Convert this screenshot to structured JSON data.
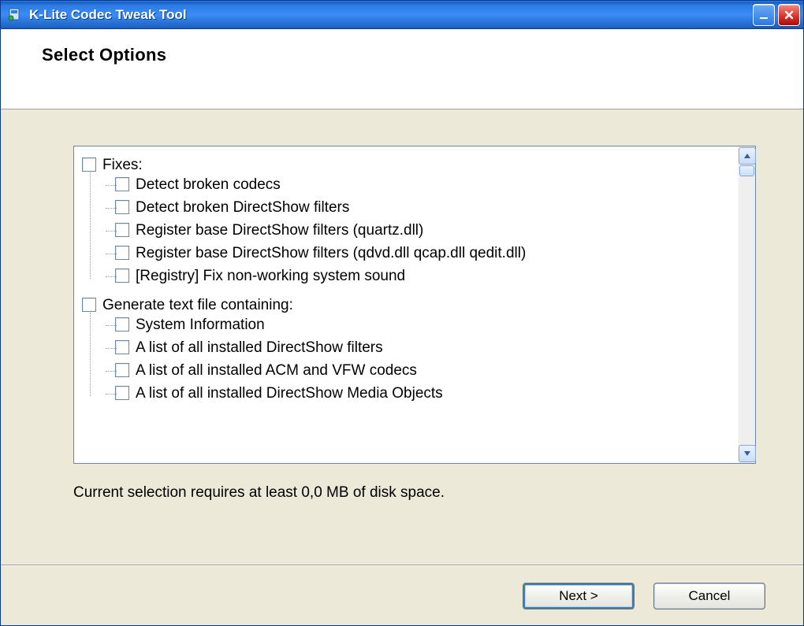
{
  "window": {
    "title": "K-Lite Codec Tweak Tool"
  },
  "header": {
    "heading": "Select Options"
  },
  "tree": {
    "groups": [
      {
        "label": "Fixes:",
        "items": [
          "Detect broken codecs",
          "Detect broken DirectShow filters",
          "Register base DirectShow filters (quartz.dll)",
          "Register base DirectShow filters (qdvd.dll qcap.dll qedit.dll)",
          "[Registry] Fix non-working system sound"
        ]
      },
      {
        "label": "Generate text file containing:",
        "items": [
          "System Information",
          "A list of all installed DirectShow filters",
          "A list of all installed ACM and VFW codecs",
          "A list of all installed DirectShow Media Objects"
        ]
      }
    ]
  },
  "status": "Current selection requires at least 0,0 MB of disk space.",
  "footer": {
    "next": "Next >",
    "cancel": "Cancel"
  }
}
